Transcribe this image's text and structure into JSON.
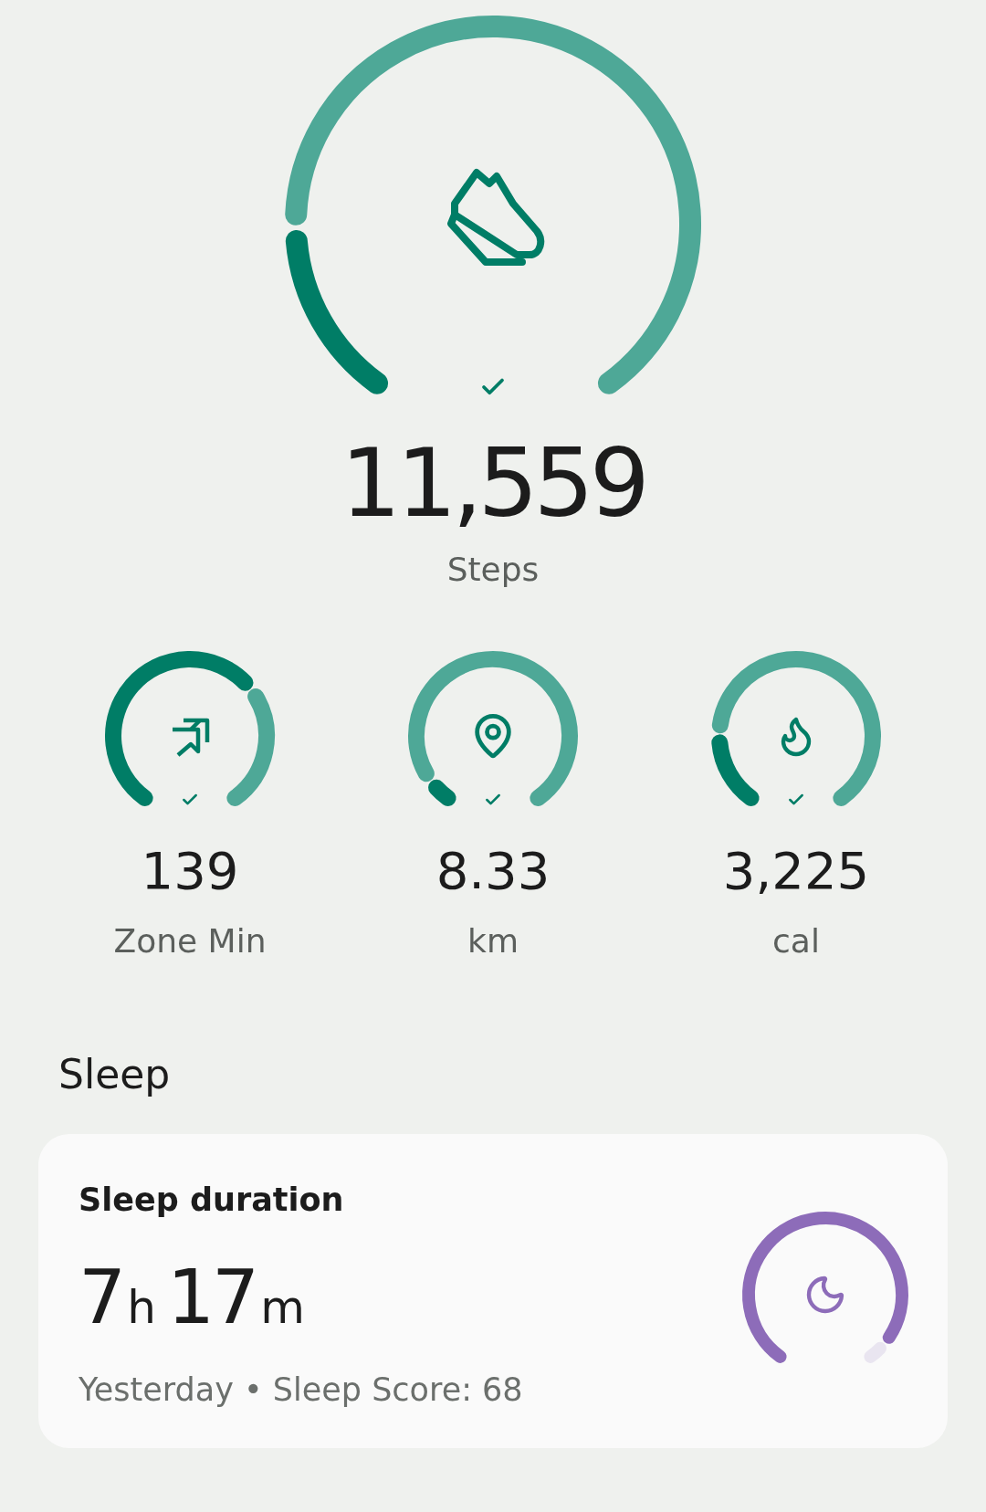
{
  "steps": {
    "value": "11,559",
    "label": "Steps",
    "goal_met": true
  },
  "metrics": [
    {
      "kind": "zone",
      "value": "139",
      "label": "Zone Min",
      "goal_met": true
    },
    {
      "kind": "distance",
      "value": "8.33",
      "label": "km",
      "goal_met": true
    },
    {
      "kind": "calories",
      "value": "3,225",
      "label": "cal",
      "goal_met": true
    }
  ],
  "sleep": {
    "heading": "Sleep",
    "card": {
      "title": "Sleep duration",
      "duration": [
        {
          "value": "7",
          "unit": "h"
        },
        {
          "value": "17",
          "unit": "m"
        }
      ],
      "footnote": "Yesterday • Sleep Score: 68"
    }
  }
}
